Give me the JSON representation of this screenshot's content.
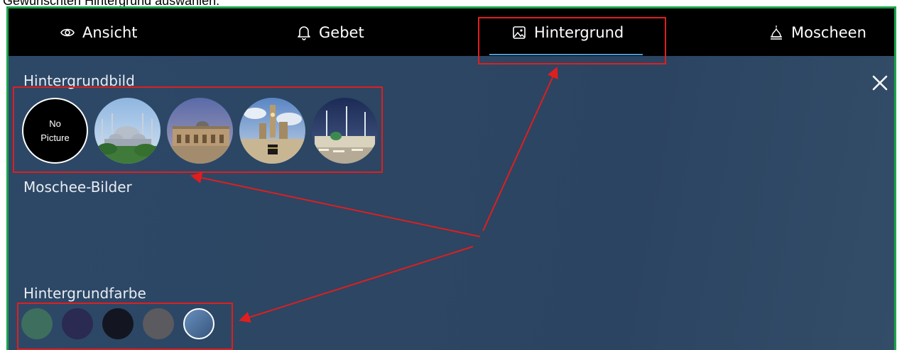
{
  "caption": "Gewünschten Hintergrund auswählen.",
  "tabs": [
    {
      "label": "Ansicht",
      "icon": "eye-icon"
    },
    {
      "label": "Gebet",
      "icon": "bell-icon"
    },
    {
      "label": "Hintergrund",
      "icon": "image-icon",
      "active": true
    },
    {
      "label": "Moscheen",
      "icon": "mosque-icon"
    }
  ],
  "sections": {
    "background_image": "Hintergrundbild",
    "mosque_images": "Moschee-Bilder",
    "background_color": "Hintergrundfarbe"
  },
  "no_picture": {
    "line1": "No",
    "line2": "Picture"
  },
  "thumbnails": [
    "mosque-blue-mosque",
    "mosque-al-aqsa",
    "mosque-kaaba-clock-tower",
    "mosque-nabawi-night"
  ],
  "colors": [
    "#3e6e5d",
    "#2a2a52",
    "#131620",
    "#5b5a5e",
    "#4a6e9a"
  ],
  "selected_color_index": 4,
  "accent": "#4a9ad6",
  "annotation_color": "#e01e1e",
  "frame_color": "#1aa34a"
}
